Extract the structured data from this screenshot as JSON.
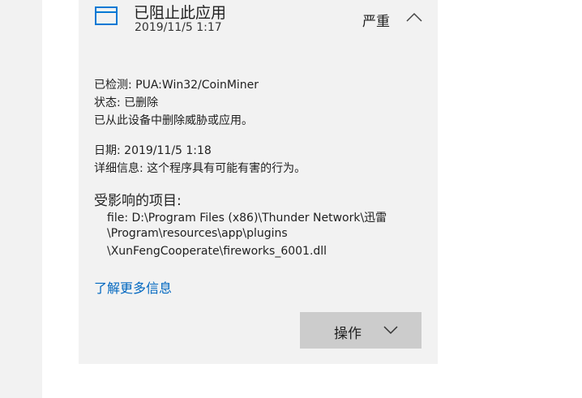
{
  "threat": {
    "title": "已阻止此应用",
    "timestamp": "2019/11/5 1:17",
    "severity": "严重",
    "icon": "app-window-icon",
    "collapse_icon": "chevron-up-icon",
    "accent_color": "#0078d4"
  },
  "details": {
    "detected": "已检测: PUA:Win32/CoinMiner",
    "status": "状态: 已删除",
    "removed_message": "已从此设备中删除威胁或应用。",
    "date": "日期: 2019/11/5 1:18",
    "info": "详细信息: 这个程序具有可能有害的行为。"
  },
  "affected": {
    "title": "受影响的项目:",
    "path_lines": [
      "file: D:\\Program Files (x86)\\Thunder Network\\迅雷",
      "\\Program\\resources\\app\\plugins",
      "\\XunFengCooperate\\fireworks_6001.dll"
    ]
  },
  "links": {
    "learn_more": "了解更多信息",
    "link_color": "#0067c0"
  },
  "actions": {
    "label": "操作",
    "icon": "chevron-down-icon"
  }
}
